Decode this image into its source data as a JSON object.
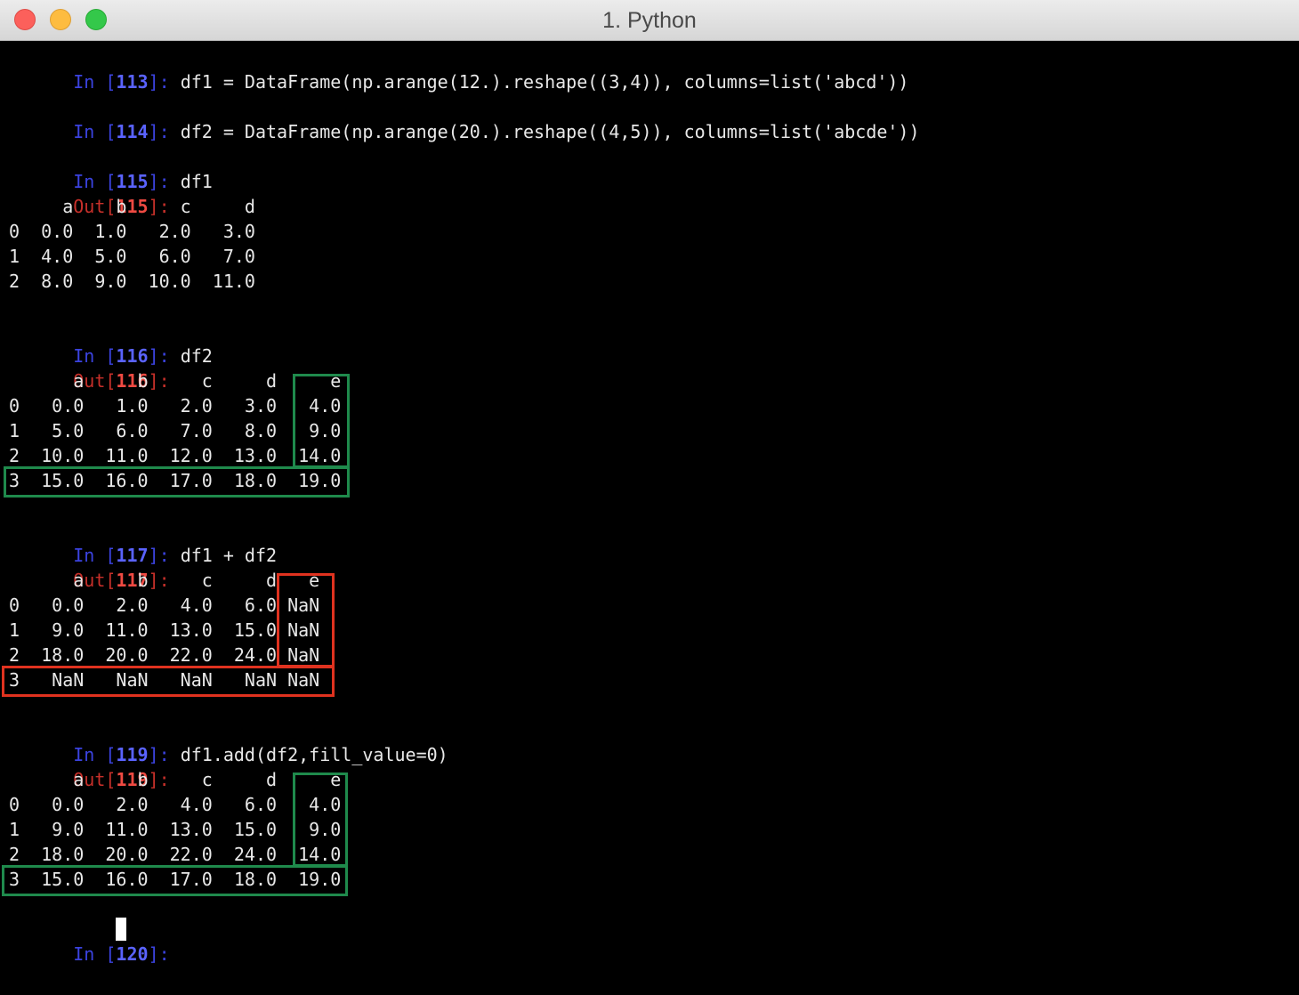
{
  "window": {
    "title": "1. Python"
  },
  "session": {
    "in113": {
      "prompt": "In ",
      "lb": "[",
      "num": "113",
      "rb": "]",
      "colon": ": ",
      "code": "df1 = DataFrame(np.arange(12.).reshape((3,4)), columns=list('abcd'))"
    },
    "in114": {
      "prompt": "In ",
      "lb": "[",
      "num": "114",
      "rb": "]",
      "colon": ": ",
      "code": "df2 = DataFrame(np.arange(20.).reshape((4,5)), columns=list('abcde'))"
    },
    "in115": {
      "prompt": "In ",
      "lb": "[",
      "num": "115",
      "rb": "]",
      "colon": ": ",
      "code": "df1"
    },
    "out115": {
      "prompt": "Out",
      "lb": "[",
      "num": "115",
      "rb": "]",
      "colon": ":"
    },
    "df1_table": [
      "     a    b     c     d",
      "0  0.0  1.0   2.0   3.0",
      "1  4.0  5.0   6.0   7.0",
      "2  8.0  9.0  10.0  11.0"
    ],
    "in116": {
      "prompt": "In ",
      "lb": "[",
      "num": "116",
      "rb": "]",
      "colon": ": ",
      "code": "df2"
    },
    "out116": {
      "prompt": "Out",
      "lb": "[",
      "num": "116",
      "rb": "]",
      "colon": ":"
    },
    "df2_table": [
      "      a     b     c     d     e",
      "0   0.0   1.0   2.0   3.0   4.0",
      "1   5.0   6.0   7.0   8.0   9.0",
      "2  10.0  11.0  12.0  13.0  14.0",
      "3  15.0  16.0  17.0  18.0  19.0"
    ],
    "in117": {
      "prompt": "In ",
      "lb": "[",
      "num": "117",
      "rb": "]",
      "colon": ": ",
      "code": "df1 + df2"
    },
    "out117": {
      "prompt": "Out",
      "lb": "[",
      "num": "117",
      "rb": "]",
      "colon": ":"
    },
    "sum_table": [
      "      a     b     c     d   e",
      "0   0.0   2.0   4.0   6.0 NaN",
      "1   9.0  11.0  13.0  15.0 NaN",
      "2  18.0  20.0  22.0  24.0 NaN",
      "3   NaN   NaN   NaN   NaN NaN"
    ],
    "in119": {
      "prompt": "In ",
      "lb": "[",
      "num": "119",
      "rb": "]",
      "colon": ": ",
      "code": "df1.add(df2,fill_value=0)"
    },
    "out119": {
      "prompt": "Out",
      "lb": "[",
      "num": "119",
      "rb": "]",
      "colon": ":"
    },
    "add_table": [
      "      a     b     c     d     e",
      "0   0.0   2.0   4.0   6.0   4.0",
      "1   9.0  11.0  13.0  15.0   9.0",
      "2  18.0  20.0  22.0  24.0  14.0",
      "3  15.0  16.0  17.0  18.0  19.0"
    ],
    "in120": {
      "prompt": "In ",
      "lb": "[",
      "num": "120",
      "rb": "]",
      "colon": ": ",
      "code": ""
    }
  },
  "colors": {
    "background": "#000000",
    "in_prompt": "#3b43e0",
    "out_prompt": "#c7302a",
    "highlight_green": "#1f8a4c",
    "highlight_red": "#e0321f"
  }
}
